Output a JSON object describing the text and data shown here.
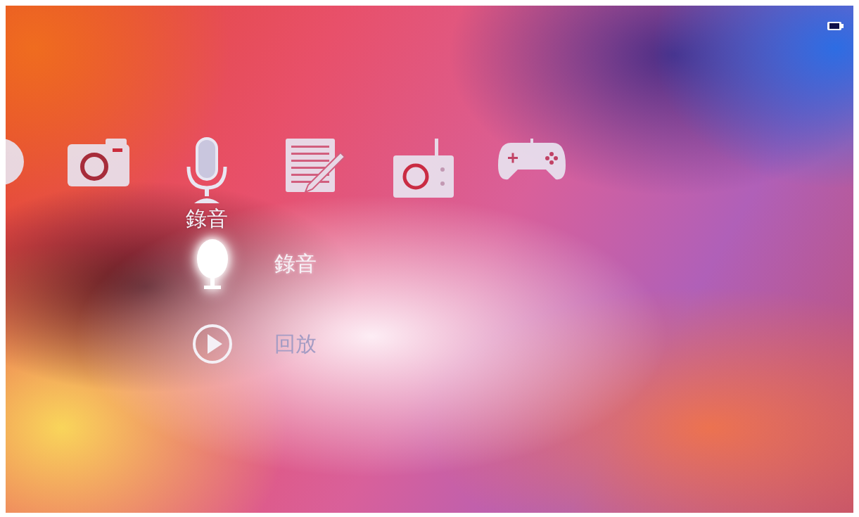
{
  "categories": [
    {
      "kind": "disc",
      "selected": false
    },
    {
      "kind": "camera",
      "selected": false
    },
    {
      "kind": "microphone",
      "selected": true,
      "label": "錄音"
    },
    {
      "kind": "notes",
      "selected": false
    },
    {
      "kind": "radio",
      "selected": false
    },
    {
      "kind": "gamepad",
      "selected": false
    }
  ],
  "menu_items": [
    {
      "kind": "record",
      "label": "錄音",
      "selected": true
    },
    {
      "kind": "playback",
      "label": "回放",
      "selected": false
    }
  ]
}
